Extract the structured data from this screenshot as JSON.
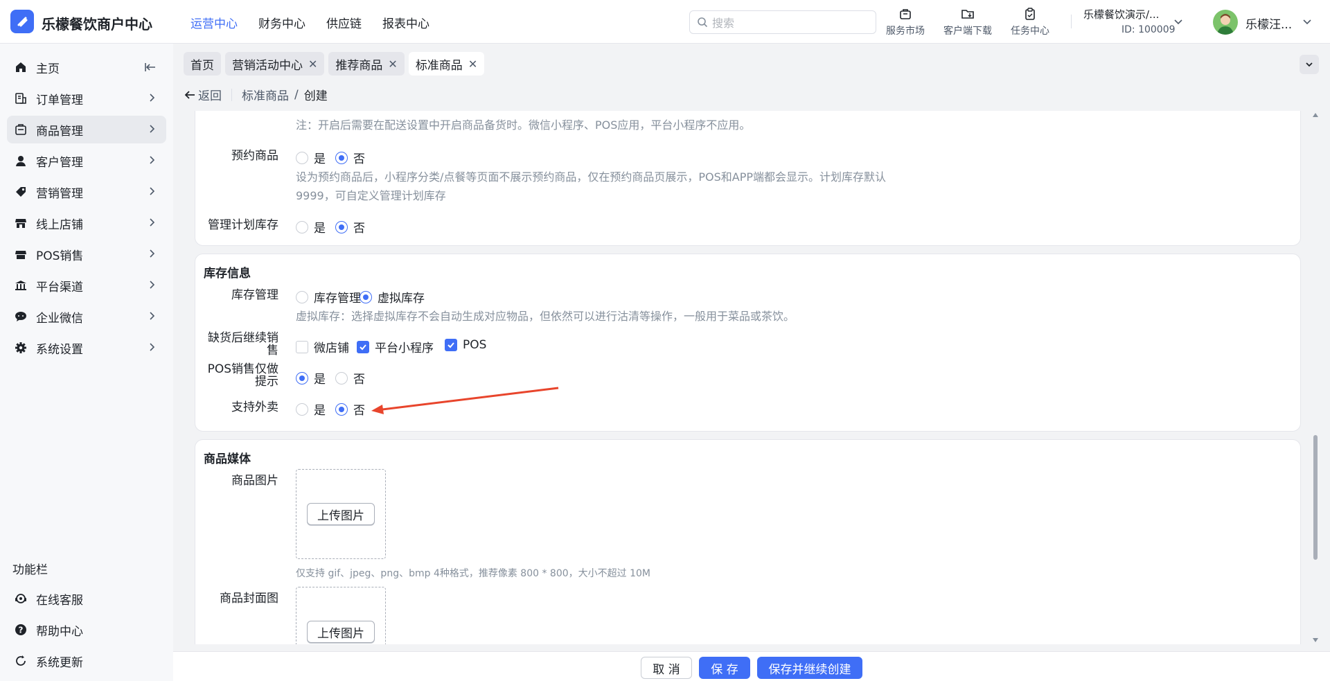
{
  "app": {
    "title": "乐檬餐饮商户中心"
  },
  "topnav": [
    {
      "label": "运营中心",
      "active": true
    },
    {
      "label": "财务中心"
    },
    {
      "label": "供应链"
    },
    {
      "label": "报表中心"
    }
  ],
  "search": {
    "placeholder": "搜索"
  },
  "tools": [
    {
      "label": "服务市场",
      "icon": "briefcase-icon"
    },
    {
      "label": "客户端下载",
      "icon": "folder-download-icon"
    },
    {
      "label": "任务中心",
      "icon": "clipboard-check-icon"
    }
  ],
  "account": {
    "store": "乐檬餐饮演示/...",
    "id": "ID: 100009",
    "user": "乐檬汪..."
  },
  "sidebar": {
    "items": [
      {
        "label": "主页",
        "icon": "home-icon"
      },
      {
        "label": "订单管理",
        "icon": "order-icon"
      },
      {
        "label": "商品管理",
        "icon": "goods-icon",
        "active": true
      },
      {
        "label": "客户管理",
        "icon": "user-icon"
      },
      {
        "label": "营销管理",
        "icon": "tag-icon"
      },
      {
        "label": "线上店铺",
        "icon": "store-icon"
      },
      {
        "label": "POS销售",
        "icon": "pos-icon"
      },
      {
        "label": "平台渠道",
        "icon": "bank-icon"
      },
      {
        "label": "企业微信",
        "icon": "chat-icon"
      },
      {
        "label": "系统设置",
        "icon": "gear-icon"
      }
    ],
    "section_title": "功能栏",
    "bottom": [
      {
        "label": "在线客服",
        "icon": "headset-icon"
      },
      {
        "label": "帮助中心",
        "icon": "help-icon"
      },
      {
        "label": "系统更新",
        "icon": "refresh-icon"
      }
    ]
  },
  "tabs": [
    {
      "label": "首页",
      "closable": false
    },
    {
      "label": "营销活动中心",
      "closable": true
    },
    {
      "label": "推荐商品",
      "closable": true
    },
    {
      "label": "标准商品",
      "closable": true,
      "active": true
    }
  ],
  "breadcrumb": {
    "back": "返回",
    "parent": "标准商品",
    "sep": "/",
    "current": "创建"
  },
  "form": {
    "note_top": "注：开启后需要在配送设置中开启商品备货时。微信小程序、POS应用，平台小程序不应用。",
    "reserve": {
      "label": "预约商品",
      "yes": "是",
      "no": "否",
      "value": "否",
      "hint1": "设为预约商品后，小程序分类/点餐等页面不展示预约商品，仅在预约商品页展示，POS和APP端都会显示。计划库存默认",
      "hint2": "9999，可自定义管理计划库存"
    },
    "plan_stock": {
      "label": "管理计划库存",
      "yes": "是",
      "no": "否",
      "value": "否"
    },
    "stock_section": {
      "title": "库存信息",
      "mode": {
        "label": "库存管理",
        "opt1": "库存管理",
        "opt2": "虚拟库存",
        "value": "虚拟库存"
      },
      "mode_hint": "虚拟库存：选择虚拟库存不会自动生成对应物品，但依然可以进行沽清等操作，一般用于菜品或茶饮。",
      "oversell": {
        "label_1": "缺货后继续销",
        "label_2": "售",
        "opt1": "微店铺",
        "opt2": "平台小程序",
        "opt3": "POS",
        "checked": [
          "平台小程序",
          "POS"
        ]
      },
      "pos_hint": {
        "label_1": "POS销售仅做",
        "label_2": "提示",
        "yes": "是",
        "no": "否",
        "value": "是"
      },
      "takeout": {
        "label": "支持外卖",
        "yes": "是",
        "no": "否",
        "value": "否"
      }
    },
    "media_section": {
      "title": "商品媒体",
      "image_label": "商品图片",
      "upload_label": "上传图片",
      "image_hint": "仅支持 gif、jpeg、png、bmp 4种格式，推荐像素 800 * 800，大小不超过 10M",
      "cover_label": "商品封面图",
      "cover_upload_label": "上传图片"
    }
  },
  "footer": {
    "cancel": "取 消",
    "save": "保 存",
    "save_next": "保存并继续创建"
  },
  "colors": {
    "accent": "#3f6ef6",
    "annotation_arrow": "#e8452c"
  }
}
